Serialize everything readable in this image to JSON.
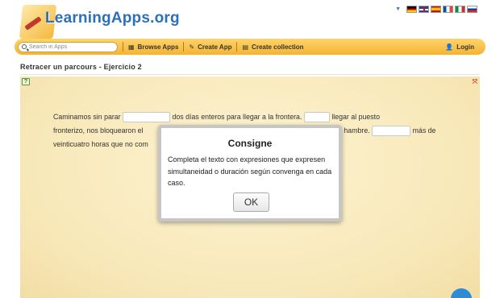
{
  "header": {
    "logo_text": "LearningApps.org",
    "languages": [
      "de",
      "gb",
      "es",
      "fr",
      "it",
      "ru"
    ]
  },
  "navbar": {
    "search_placeholder": "Search in Apps",
    "items": [
      {
        "label": "Browse Apps",
        "icon": "grid-icon"
      },
      {
        "label": "Create App",
        "icon": "pencil-icon"
      },
      {
        "label": "Create collection",
        "icon": "collection-icon"
      }
    ],
    "login_label": "Login",
    "login_icon": "user-icon"
  },
  "page_title": "Retracer un parcours - Ejercicio 2",
  "exercise": {
    "t1": "Caminamos sin parar",
    "t2": "dos días enteros para llegar a la frontera.",
    "t3": "llegar al puesto",
    "t4": "fronterizo, nos bloquearon el",
    "t5": "hambre.",
    "t6": "más de",
    "t7": "veinticuatro horas que no com"
  },
  "modal": {
    "title": "Consigne",
    "text": "Completa el texto con expresiones que expresen simultaneidad o duración según convenga en cada caso.",
    "ok_label": "OK"
  }
}
